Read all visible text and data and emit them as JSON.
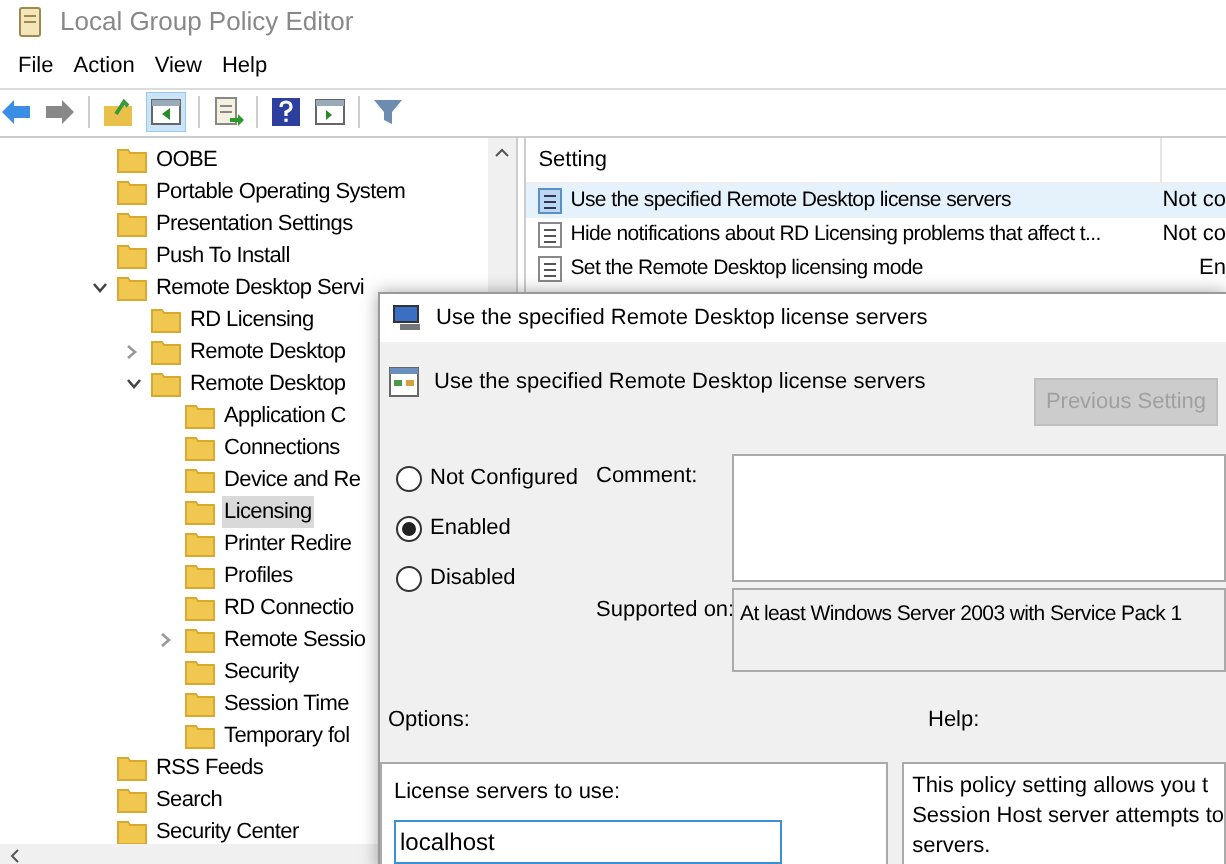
{
  "window": {
    "title": "Local Group Policy Editor"
  },
  "menu": [
    "File",
    "Action",
    "View",
    "Help"
  ],
  "tree": [
    {
      "label": "OOBE",
      "selected": false
    },
    {
      "label": "Portable Operating System",
      "selected": false
    },
    {
      "label": "Presentation Settings",
      "selected": false
    },
    {
      "label": "Push To Install",
      "selected": false
    },
    {
      "label": "Remote Desktop Servi",
      "selected": false,
      "expanded": true,
      "children": [
        {
          "label": "RD Licensing",
          "selected": false
        },
        {
          "label": "Remote Desktop",
          "selected": false,
          "expanded": false
        },
        {
          "label": "Remote Desktop",
          "selected": false,
          "expanded": true,
          "children": [
            {
              "label": "Application C",
              "selected": false
            },
            {
              "label": "Connections",
              "selected": false
            },
            {
              "label": "Device and Re",
              "selected": false
            },
            {
              "label": "Licensing",
              "selected": true
            },
            {
              "label": "Printer Redire",
              "selected": false
            },
            {
              "label": "Profiles",
              "selected": false
            },
            {
              "label": "RD Connectio",
              "selected": false
            },
            {
              "label": "Remote Sessio",
              "selected": false,
              "expanded": false
            },
            {
              "label": "Security",
              "selected": false
            },
            {
              "label": "Session Time",
              "selected": false
            },
            {
              "label": "Temporary fol",
              "selected": false
            }
          ]
        }
      ]
    },
    {
      "label": "RSS Feeds",
      "selected": false
    },
    {
      "label": "Search",
      "selected": false
    },
    {
      "label": "Security Center",
      "selected": false
    }
  ],
  "settings_list": {
    "columns": [
      "Setting"
    ],
    "rows": [
      {
        "setting": "Use the specified Remote Desktop license servers",
        "state": "Not co",
        "selected": true
      },
      {
        "setting": "Hide notifications about RD Licensing problems that affect t...",
        "state": "Not co",
        "selected": false
      },
      {
        "setting": "Set the Remote Desktop licensing mode",
        "state": "En",
        "selected": false
      }
    ]
  },
  "dialog": {
    "title": "Use the specified Remote Desktop license servers",
    "heading": "Use the specified Remote Desktop license servers",
    "previous_button": {
      "label": "Previous Setting",
      "disabled": true
    },
    "radios": [
      {
        "label": "Not Configured",
        "selected": false
      },
      {
        "label": "Enabled",
        "selected": true
      },
      {
        "label": "Disabled",
        "selected": false
      }
    ],
    "comment_label": "Comment:",
    "supported_label": "Supported on:",
    "supported_value": "At least Windows Server 2003 with Service Pack 1",
    "options_label": "Options:",
    "help_label": "Help:",
    "license_servers_label": "License servers to use:",
    "license_servers_value": "localhost",
    "help_lines": [
      "This policy setting allows you t",
      "Session Host server attempts to",
      "servers."
    ]
  }
}
